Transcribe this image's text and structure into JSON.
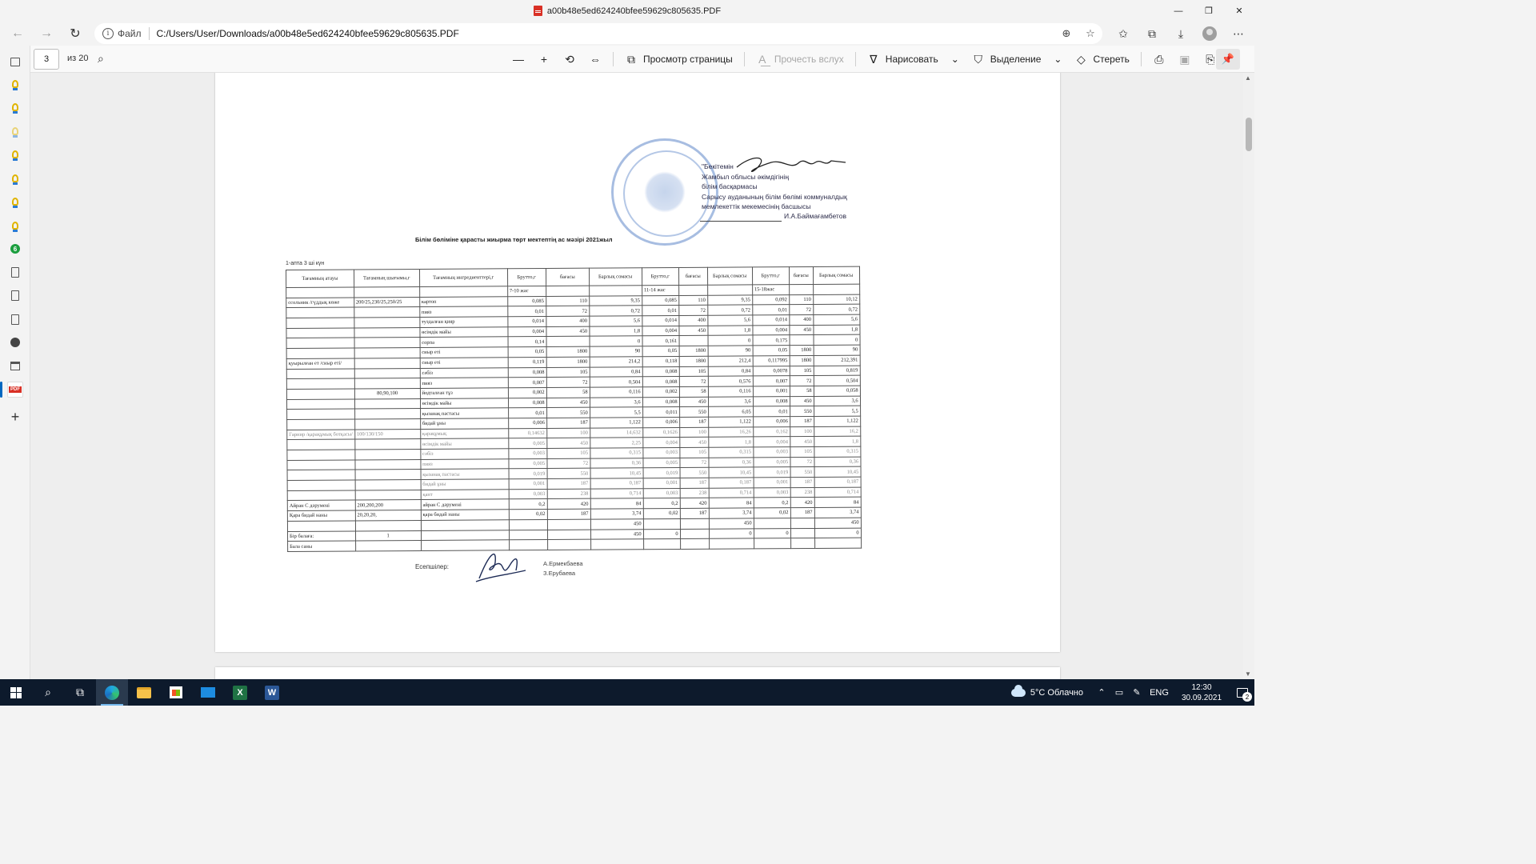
{
  "window": {
    "title": "a00b48e5ed624240bfee59629c805635.PDF",
    "controls": {
      "minimize": "—",
      "restore": "❐",
      "close": "✕"
    }
  },
  "navbar": {
    "scheme": "Файл",
    "url": "C:/Users/User/Downloads/a00b48e5ed624240bfee59629c805635.PDF"
  },
  "pdf_toolbar": {
    "page_current": "3",
    "page_total": "из 20",
    "page_view_label": "Просмотр страницы",
    "read_aloud_label": "Прочесть вслух",
    "draw_label": "Нарисовать",
    "highlight_label": "Выделение",
    "erase_label": "Стереть"
  },
  "document": {
    "approve_lines": [
      "\"Бекітемін",
      "Жамбыл облысы  әкімдігінің",
      "білім басқармасы",
      "Сарысу ауданының білім бөлімі коммуналдық",
      "мемлекеттік мекемесінің басшысы"
    ],
    "signer": "И.А.Баймағамбетов",
    "title": "Білім бөліміне қарасты жиырма төрт мектептің ас мәзірі  2021жыл",
    "week_label": "1-апта 3 ші күн",
    "headers": [
      "Тағамның атауы",
      "Тағамның шығымы,г",
      "Тағамның ингредиенттері,г",
      "Брутто,г",
      "бағасы",
      "Барлық сомасы",
      "Брутто,г",
      "бағасы",
      "Барлық сомасы",
      "Брутто,г",
      "бағасы",
      "Барлық сомасы"
    ],
    "age_groups": [
      "7-10 жас",
      "11-14 жас",
      "15-18жас"
    ],
    "rows": [
      [
        "ссольник /гүддық көже",
        "200/25,230/25,250/25",
        "картоп",
        "0,085",
        "110",
        "9,35",
        "0,085",
        "110",
        "9,35",
        "0,092",
        "110",
        "10,12"
      ],
      [
        "",
        "",
        "пияз",
        "0,01",
        "72",
        "0,72",
        "0,01",
        "72",
        "0,72",
        "0,01",
        "72",
        "0,72"
      ],
      [
        "",
        "",
        "туздалған қияр",
        "0,014",
        "400",
        "5,6",
        "0,014",
        "400",
        "5,6",
        "0,014",
        "400",
        "5,6"
      ],
      [
        "",
        "",
        "өсімдік майы",
        "0,004",
        "450",
        "1,8",
        "0,004",
        "450",
        "1,8",
        "0,004",
        "450",
        "1,8"
      ],
      [
        "",
        "",
        "сорпа",
        "0,14",
        "",
        "0",
        "0,161",
        "",
        "0",
        "0,175",
        "",
        "0"
      ],
      [
        "",
        "",
        "сиыр еті",
        "0,05",
        "1800",
        "90",
        "0,05",
        "1800",
        "90",
        "0,05",
        "1800",
        "90"
      ],
      [
        "қуырылған ет /сиыр еті/",
        "",
        "сиыр еті",
        "0,119",
        "1800",
        "214,2",
        "0,118",
        "1800",
        "212,4",
        "0,117995",
        "1800",
        "212,391"
      ],
      [
        "",
        "",
        "сәбіз",
        "0,008",
        "105",
        "0,84",
        "0,008",
        "105",
        "0,84",
        "0,0078",
        "105",
        "0,819"
      ],
      [
        "",
        "",
        "пияз",
        "0,007",
        "72",
        "0,504",
        "0,008",
        "72",
        "0,576",
        "0,007",
        "72",
        "0,504"
      ],
      [
        "",
        "80,90,100",
        "йодталған тұз",
        "0,002",
        "58",
        "0,116",
        "0,002",
        "58",
        "0,116",
        "0,001",
        "58",
        "0,058"
      ],
      [
        "",
        "",
        "өсімдік майы",
        "0,008",
        "450",
        "3,6",
        "0,008",
        "450",
        "3,6",
        "0,008",
        "450",
        "3,6"
      ],
      [
        "",
        "",
        "қызанақ пастасы",
        "0,01",
        "550",
        "5,5",
        "0,011",
        "550",
        "6,05",
        "0,01",
        "550",
        "5,5"
      ],
      [
        "",
        "",
        "бидай ұны",
        "0,006",
        "187",
        "1,122",
        "0,006",
        "187",
        "1,122",
        "0,006",
        "187",
        "1,122"
      ],
      [
        "Гарнир /қарақұмық ботқасы/",
        "100/130/150",
        "қарақұмық",
        "0,14632",
        "100",
        "14,632",
        "0,1626",
        "100",
        "16,26",
        "0,162",
        "100",
        "16,2"
      ],
      [
        "",
        "",
        "өсімдік майы",
        "0,005",
        "450",
        "2,25",
        "0,004",
        "450",
        "1,8",
        "0,004",
        "450",
        "1,8"
      ],
      [
        "",
        "",
        "сәбіз",
        "0,003",
        "105",
        "0,315",
        "0,003",
        "105",
        "0,315",
        "0,003",
        "105",
        "0,315"
      ],
      [
        "",
        "",
        "пияз",
        "0,005",
        "72",
        "0,36",
        "0,005",
        "72",
        "0,36",
        "0,005",
        "72",
        "0,36"
      ],
      [
        "",
        "",
        "қызанақ пастасы",
        "0,019",
        "550",
        "10,45",
        "0,019",
        "550",
        "10,45",
        "0,019",
        "550",
        "10,45"
      ],
      [
        "",
        "",
        "бидай ұны",
        "0,001",
        "187",
        "0,187",
        "0,001",
        "187",
        "0,187",
        "0,001",
        "187",
        "0,187"
      ],
      [
        "",
        "",
        "қант",
        "0,003",
        "238",
        "0,714",
        "0,003",
        "238",
        "0,714",
        "0,003",
        "238",
        "0,714"
      ],
      [
        "Айран  С дәрумені",
        "200,200,200",
        "айран С дәрумені",
        "0,2",
        "420",
        "84",
        "0,2",
        "420",
        "84",
        "0,2",
        "420",
        "84"
      ],
      [
        "Қара бидай наны",
        "20,20,20,",
        "қара бидай наны",
        "0,02",
        "187",
        "3,74",
        "0,02",
        "187",
        "3,74",
        "0,02",
        "187",
        "3,74"
      ],
      [
        "",
        "",
        "",
        "",
        "",
        "450",
        "",
        "",
        "450",
        "",
        "",
        "450"
      ],
      [
        "Бір балаға:",
        "1",
        "",
        "",
        "",
        "450",
        "0",
        "",
        "0",
        "0",
        "",
        "0"
      ],
      [
        "Бала саны",
        "",
        "",
        "",
        "",
        "",
        "",
        "",
        "",
        "",
        "",
        ""
      ]
    ],
    "accountants_label": "Есепшілер:",
    "accountants": [
      "А.Ермекбаева",
      "З.Ерубаева"
    ]
  },
  "taskbar": {
    "weather": "5°C  Облачно",
    "lang": "ENG",
    "time": "12:30",
    "date": "30.09.2021",
    "notifications": "2"
  }
}
